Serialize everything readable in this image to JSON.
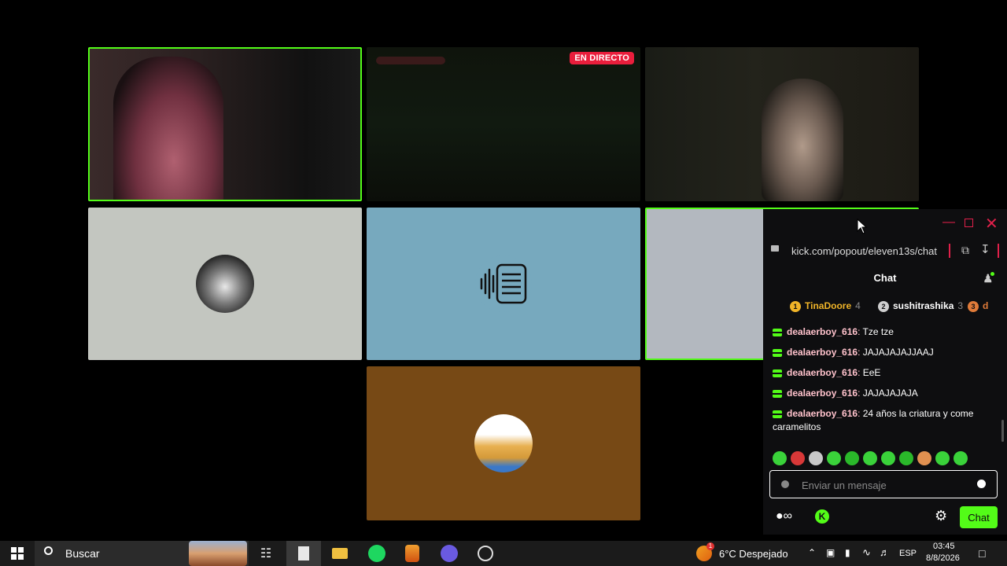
{
  "stream": {
    "live_badge": "EN DIRECTO"
  },
  "popup": {
    "url": "kick.com/popout/eleven13s/chat",
    "chat_title": "Chat",
    "gifters": [
      {
        "rank": "1",
        "name": "TinaDoore",
        "count": "4",
        "color": "#f0b428"
      },
      {
        "rank": "2",
        "name": "sushitrashika",
        "count": "3",
        "color": "#cfcfcf"
      },
      {
        "rank": "3",
        "name": "d",
        "count": "",
        "color": "#e07b39"
      }
    ],
    "messages": [
      {
        "user": "dealaerboy_616",
        "text": " Tze tze"
      },
      {
        "user": "dealaerboy_616",
        "text": " JAJAJAJAJJAAJ"
      },
      {
        "user": "dealaerboy_616",
        "text": " EeE"
      },
      {
        "user": "dealaerboy_616",
        "text": " JAJAJAJAJA"
      },
      {
        "user": "dealaerboy_616",
        "text": " 24 años la criatura y come caramelitos"
      }
    ],
    "input_placeholder": "Enviar un mensaje",
    "send_label": "Chat"
  },
  "taskbar": {
    "search_label": "Buscar",
    "weather": "6°C Despejado",
    "weather_alert": "1",
    "language": "ESP",
    "time": "03:45",
    "date": "8/8/2026"
  },
  "colors": {
    "kick_green": "#53fc18",
    "live_red": "#e91e3c",
    "chat_bg": "#0e0e10",
    "username_pink": "#ffc2cc"
  }
}
